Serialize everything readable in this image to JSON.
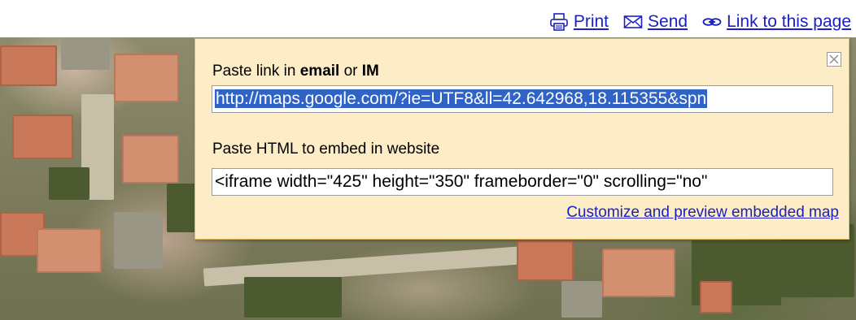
{
  "toolbar": {
    "print": {
      "label": "Print",
      "icon": "printer-icon"
    },
    "send": {
      "label": "Send",
      "icon": "envelope-icon"
    },
    "link": {
      "label": "Link to this page",
      "icon": "chain-link-icon"
    }
  },
  "popup": {
    "link_label_prefix": "Paste link in ",
    "link_label_email": "email",
    "link_label_or": " or ",
    "link_label_im": "IM",
    "link_value": "http://maps.google.com/?ie=UTF8&ll=42.642968,18.115355&spn",
    "embed_label": "Paste HTML to embed in website",
    "embed_value": "<iframe width=\"425\" height=\"350\" frameborder=\"0\" scrolling=\"no\"",
    "customize_label": "Customize and preview embedded map",
    "close_icon": "close-icon"
  },
  "colors": {
    "link": "#1a20c4",
    "popup_bg": "#fdedc6",
    "popup_border": "#e2b65e",
    "selection": "#3063c8"
  }
}
